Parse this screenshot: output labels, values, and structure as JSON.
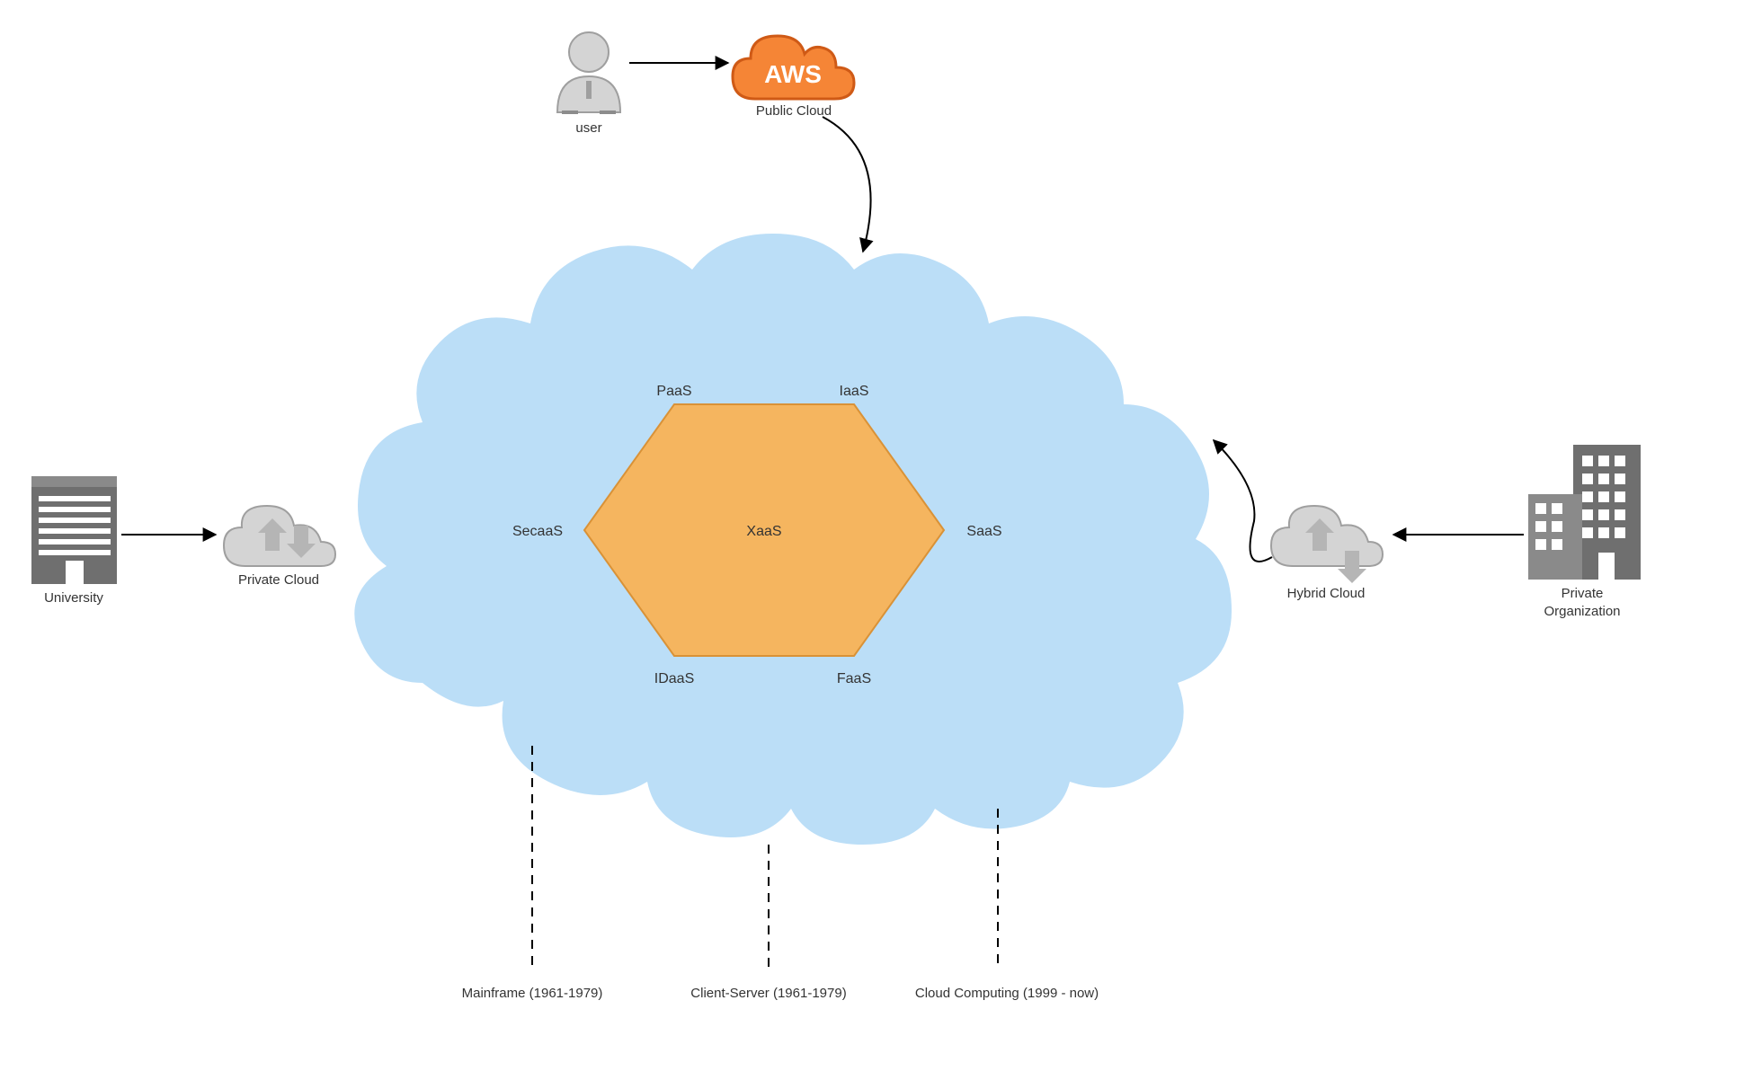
{
  "nodes": {
    "user": "user",
    "publicCloud": "Public Cloud",
    "university": "University",
    "privateCloud": "Private Cloud",
    "hybridCloud": "Hybrid Cloud",
    "privateOrg": "Private\nOrganization",
    "hexCenter": "XaaS",
    "hexTop1": "PaaS",
    "hexTop2": "IaaS",
    "hexRight": "SaaS",
    "hexBot2": "FaaS",
    "hexBot1": "IDaaS",
    "hexLeft": "SecaaS",
    "awsText": "AWS"
  },
  "timeline": {
    "era1": "Mainframe (1961-1979)",
    "era2": "Client-Server (1961-1979)",
    "era3": "Cloud Computing (1999 - now)"
  },
  "colors": {
    "cloudFill": "#bbdef7",
    "hexFill": "#f5b55f",
    "hexStroke": "#d99237",
    "awsOrange": "#f58536",
    "grayIcon": "#b9b9b9",
    "grayIconLight": "#d4d4d4",
    "buildingDark": "#6f6f6f",
    "buildingLight": "#8a8a8a"
  }
}
